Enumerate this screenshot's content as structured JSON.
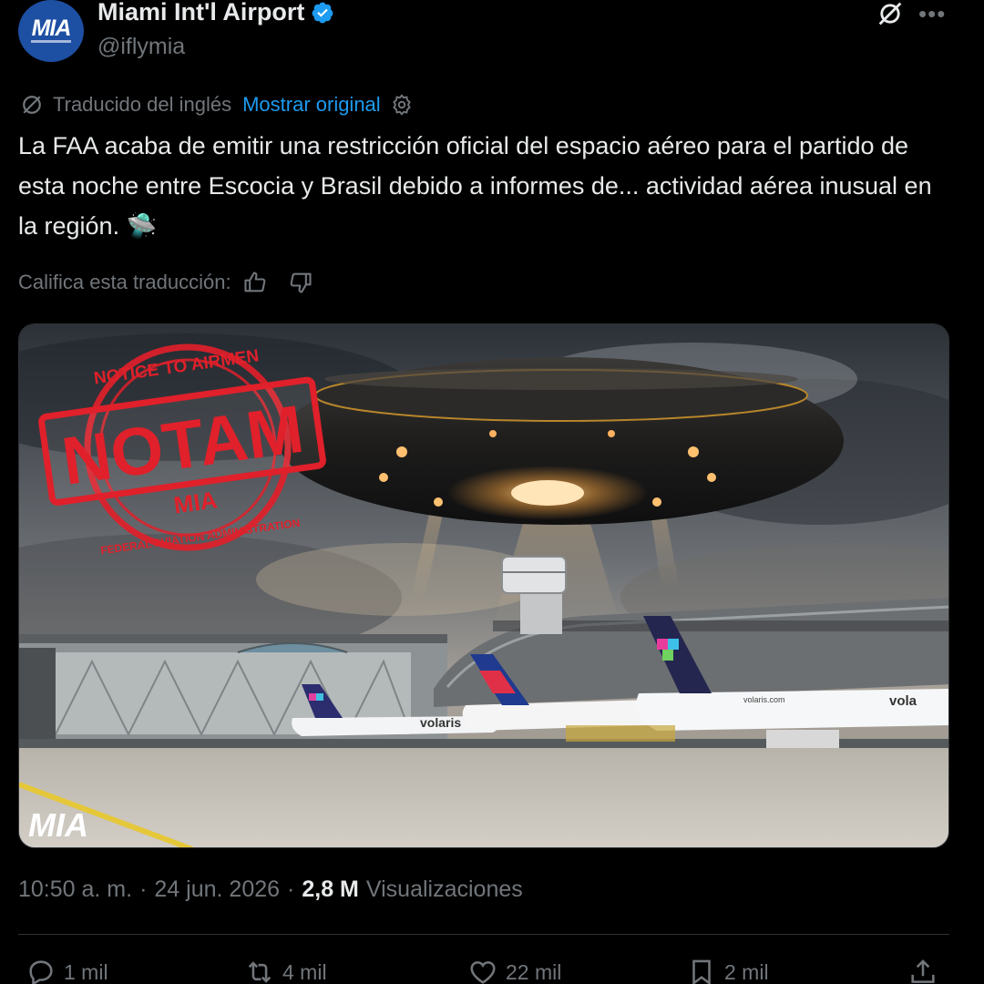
{
  "author": {
    "display_name": "Miami Int'l Airport",
    "handle": "@iflymia",
    "avatar_text": "MIA",
    "verified_color": "#1d9bf0"
  },
  "translation": {
    "label": "Traducido del inglés",
    "show_original": "Mostrar original",
    "rate_label": "Califica esta traducción:"
  },
  "tweet": {
    "text": "La FAA acaba de emitir una restricción oficial del espacio aéreo para el partido de esta noche entre Escocia y Brasil debido a informes de... actividad aérea inusual en la región. 🛸"
  },
  "media": {
    "stamp_top": "NOTICE TO AIRMEN",
    "stamp_main": "NOTAM",
    "stamp_sub": "MIA",
    "stamp_bottom": "FEDERAL AVIATION ADMINISTRATION",
    "watermark": "MIA",
    "plane_livery_1": "volaris",
    "plane_livery_2": "volaris.com",
    "plane_livery_3": "vola"
  },
  "meta": {
    "time": "10:50 a. m.",
    "sep1": "·",
    "date": "24 jun. 2026",
    "sep2": "·",
    "views_count": "2,8 M",
    "views_label": "Visualizaciones"
  },
  "actions": {
    "replies": "1 mil",
    "reposts": "4 mil",
    "likes": "22 mil",
    "bookmarks": "2 mil"
  },
  "colors": {
    "background": "#000000",
    "text": "#e7e9ea",
    "muted": "#71767b",
    "link": "#1d9bf0",
    "stamp_red": "#e0202a",
    "brand_blue": "#1d4fa3"
  },
  "icons": {
    "verified": "verified-badge-icon",
    "grok": "grok-icon",
    "more": "more-icon",
    "translate": "translate-icon",
    "settings": "settings-icon",
    "thumb_up": "thumb-up-icon",
    "thumb_down": "thumb-down-icon",
    "reply": "reply-icon",
    "repost": "repost-icon",
    "like": "like-icon",
    "bookmark": "bookmark-icon",
    "share": "share-icon"
  }
}
